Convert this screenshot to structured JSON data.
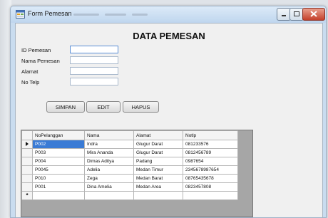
{
  "window": {
    "title": "Form Pemesan",
    "min_icon": "minimize-icon",
    "max_icon": "maximize-icon",
    "close_icon": "close-icon"
  },
  "form": {
    "heading": "DATA PEMESAN",
    "labels": {
      "id": "ID Pemesan",
      "nama": "Nama Pemesan",
      "alamat": "Alamat",
      "telp": "No Telp"
    },
    "values": {
      "id": "",
      "nama": "",
      "alamat": "",
      "telp": ""
    }
  },
  "buttons": {
    "simpan": "SIMPAN",
    "edit": "EDIT",
    "hapus": "HAPUS"
  },
  "grid": {
    "columns": [
      "NoPelanggan",
      "Nama",
      "Alamat",
      "Notlp"
    ],
    "rows": [
      [
        "P002",
        "Indra",
        "Glugur Darat",
        "081233576"
      ],
      [
        "P003",
        "Mira Ananda",
        "Glugur Darat",
        "0812456789"
      ],
      [
        "P004",
        "Dimas Aditya",
        "Padang",
        "0987654"
      ],
      [
        "P0045",
        "Adelia",
        "Medan Timur",
        "2345678987654"
      ],
      [
        "P010",
        "Zega",
        "Medan Barat",
        "08765435678"
      ],
      [
        "P001",
        "Dina Amelia",
        "Medan Area",
        "0823457808"
      ],
      [
        "",
        "",
        "",
        ""
      ]
    ],
    "current_row_marker": "current-row-arrow-icon",
    "new_row_marker": "*",
    "selection_color": "#3a7bd5"
  }
}
